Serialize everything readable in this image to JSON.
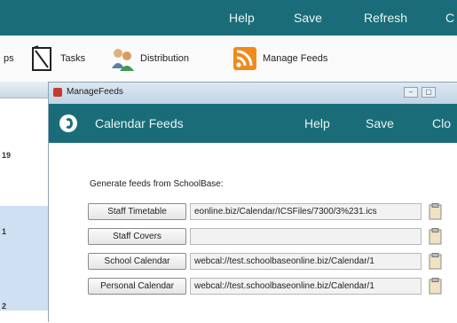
{
  "main": {
    "menu": [
      "Help",
      "Save",
      "Refresh",
      "C"
    ],
    "toolbar": [
      {
        "label": "ps",
        "icon": "partial-icon"
      },
      {
        "label": "Tasks",
        "icon": "checklist-icon"
      },
      {
        "label": "Distribution",
        "icon": "people-icon"
      },
      {
        "label": "Manage Feeds",
        "icon": "rss-feed-icon"
      }
    ],
    "left_rows": [
      "19",
      "1",
      "2"
    ]
  },
  "window": {
    "title": "ManageFeeds",
    "header_title": "Calendar Feeds",
    "menu": [
      "Help",
      "Save",
      "Clo"
    ],
    "generate_label": "Generate feeds from SchoolBase:",
    "feeds": [
      {
        "label": "Staff Timetable",
        "url": "eonline.biz/Calendar/ICSFiles/7300/3%231.ics"
      },
      {
        "label": "Staff Covers",
        "url": ""
      },
      {
        "label": "School Calendar",
        "url": "webcal://test.schoolbaseonline.biz/Calendar/1"
      },
      {
        "label": "Personal Calendar",
        "url": "webcal://test.schoolbaseonline.biz/Calendar/1"
      }
    ]
  },
  "colors": {
    "teal": "#1a6d78",
    "rss_orange": "#f08a1c"
  }
}
